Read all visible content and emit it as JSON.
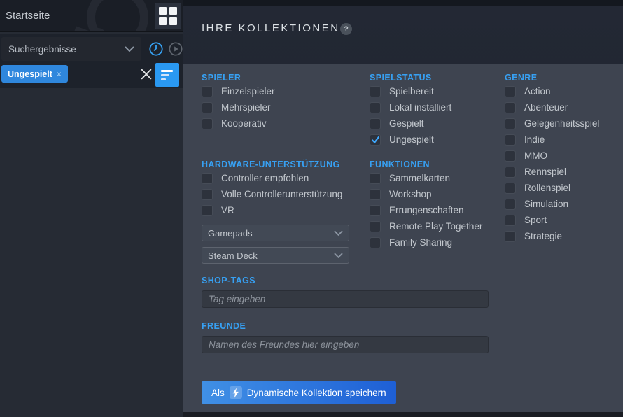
{
  "colors": {
    "accent_blue": "#37a0f2",
    "chip_blue": "#2f87dd",
    "filter_button_blue": "#2a99f2",
    "panel_bg": "#3e4450",
    "checkmark_blue": "#3fa9ff",
    "save_gradient_left": "#4090e5",
    "save_gradient_right": "#1e5fd5"
  },
  "sidebar": {
    "home_label": "Startseite",
    "collection_select": {
      "value": "Suchergebnisse"
    },
    "filter_chip": {
      "label": "Ungespielt",
      "remove_glyph": "×"
    },
    "icons": [
      "grid-icon",
      "chevron-down-icon",
      "history-clock-icon",
      "play-circle-icon",
      "close-icon",
      "filter-icon",
      "steam-logo-watermark"
    ]
  },
  "main": {
    "title": "IHRE KOLLEKTIONEN",
    "help_glyph": "?"
  },
  "panel": {
    "spieler": {
      "title": "SPIELER",
      "items": [
        {
          "label": "Einzelspieler",
          "checked": false
        },
        {
          "label": "Mehrspieler",
          "checked": false
        },
        {
          "label": "Kooperativ",
          "checked": false
        }
      ]
    },
    "spielstatus": {
      "title": "SPIELSTATUS",
      "items": [
        {
          "label": "Spielbereit",
          "checked": false
        },
        {
          "label": "Lokal installiert",
          "checked": false
        },
        {
          "label": "Gespielt",
          "checked": false
        },
        {
          "label": "Ungespielt",
          "checked": true
        }
      ]
    },
    "genre": {
      "title": "GENRE",
      "items": [
        {
          "label": "Action",
          "checked": false
        },
        {
          "label": "Abenteuer",
          "checked": false
        },
        {
          "label": "Gelegenheitsspiel",
          "checked": false
        },
        {
          "label": "Indie",
          "checked": false
        },
        {
          "label": "MMO",
          "checked": false
        },
        {
          "label": "Rennspiel",
          "checked": false
        },
        {
          "label": "Rollenspiel",
          "checked": false
        },
        {
          "label": "Simulation",
          "checked": false
        },
        {
          "label": "Sport",
          "checked": false
        },
        {
          "label": "Strategie",
          "checked": false
        }
      ]
    },
    "hardware": {
      "title": "HARDWARE-UNTERSTÜTZUNG",
      "items": [
        {
          "label": "Controller empfohlen",
          "checked": false
        },
        {
          "label": "Volle Controllerunterstützung",
          "checked": false
        },
        {
          "label": "VR",
          "checked": false
        }
      ],
      "dropdowns": [
        {
          "value": "Gamepads"
        },
        {
          "value": "Steam Deck"
        }
      ]
    },
    "funktionen": {
      "title": "FUNKTIONEN",
      "items": [
        {
          "label": "Sammelkarten",
          "checked": false
        },
        {
          "label": "Workshop",
          "checked": false
        },
        {
          "label": "Errungenschaften",
          "checked": false
        },
        {
          "label": "Remote Play Together",
          "checked": false
        },
        {
          "label": "Family Sharing",
          "checked": false
        }
      ]
    },
    "shop_tags": {
      "title": "SHOP-TAGS",
      "placeholder": "Tag eingeben"
    },
    "freunde": {
      "title": "FREUNDE",
      "placeholder": "Namen des Freundes hier eingeben"
    },
    "save_button": {
      "prefix": "Als",
      "label": "Dynamische Kollektion speichern"
    }
  }
}
